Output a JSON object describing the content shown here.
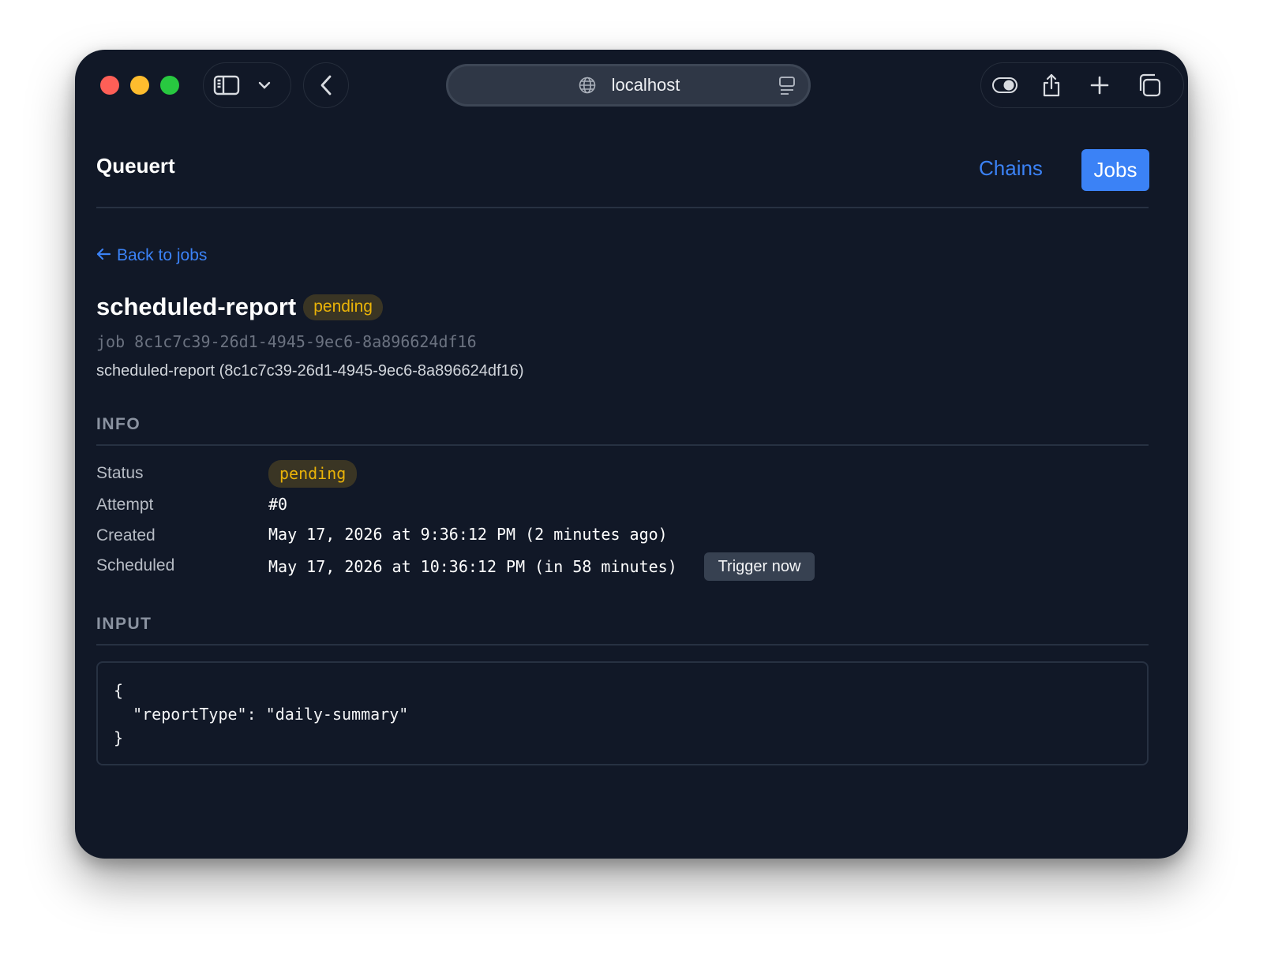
{
  "browser": {
    "url": "localhost",
    "icons": {
      "sidebar": "sidebar-icon",
      "chevron": "chevron-down-icon",
      "back": "chevron-left-icon",
      "globe": "globe-icon",
      "reader": "reader-icon",
      "toggle": "toggle-icon",
      "share": "share-icon",
      "new_tab": "plus-icon",
      "tabs": "tabs-overview-icon"
    }
  },
  "header": {
    "app_title": "Queuert",
    "nav": {
      "chains_label": "Chains",
      "jobs_label": "Jobs"
    }
  },
  "job": {
    "back_label": "Back to jobs",
    "type_name": "scheduled-report",
    "status_badge": "pending",
    "id_line": "job 8c1c7c39-26d1-4945-9ec6-8a896624df16",
    "description": "scheduled-report (8c1c7c39-26d1-4945-9ec6-8a896624df16)"
  },
  "info": {
    "heading": "INFO",
    "status_label": "Status",
    "status_value": "pending",
    "attempt_label": "Attempt",
    "attempt_value": "#0",
    "created_label": "Created",
    "created_value": "May 17, 2026 at 9:36:12 PM (2 minutes ago)",
    "scheduled_label": "Scheduled",
    "scheduled_value": "May 17, 2026 at 10:36:12 PM (in 58 minutes)",
    "trigger_label": "Trigger now"
  },
  "input": {
    "heading": "INPUT",
    "code": "{\n  \"reportType\": \"daily-summary\"\n}"
  },
  "colors": {
    "background": "#111827",
    "accent": "#3b82f6",
    "pending": "#eab308"
  }
}
